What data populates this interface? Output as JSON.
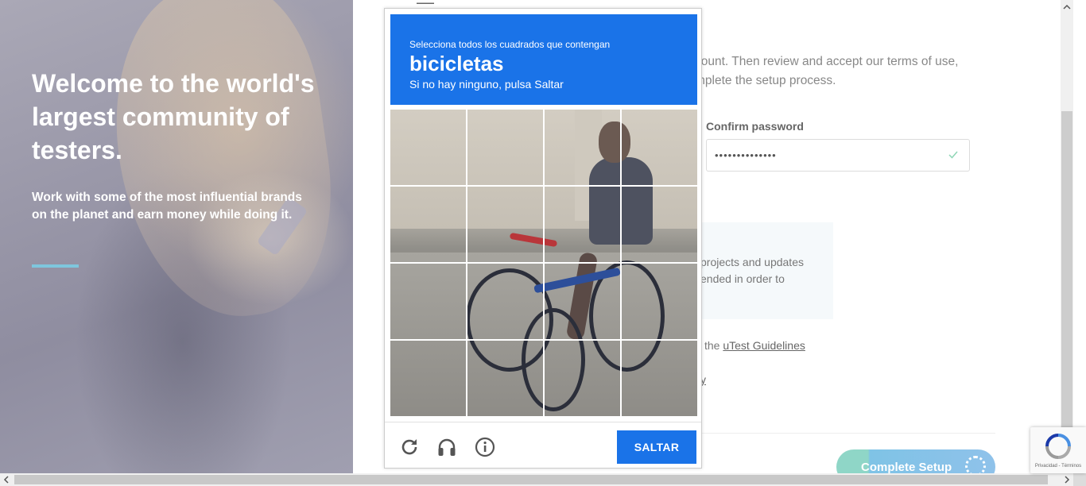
{
  "hero": {
    "title": "Welcome to the world's largest community of testers.",
    "subtitle": "Work with some of the most influential brands on the planet and earn money while doing it."
  },
  "form": {
    "intro_line1": "count. Then review and accept our terms of use,",
    "intro_line2": "mplete the setup process.",
    "confirm_label": "Confirm password",
    "confirm_value": "••••••••••••••",
    "info_line1": "projects and updates",
    "info_line2": "ended in order to",
    "guidelines_prefix": "the ",
    "guidelines_link": "uTest Guidelines",
    "policy_fragment": "y",
    "complete_button": "Complete Setup"
  },
  "captcha": {
    "instruction": "Selecciona todos los cuadrados que contengan",
    "target": "bicicletas",
    "skip_hint": "Si no hay ninguno, pulsa Saltar",
    "skip_button": "SALTAR",
    "grid_rows": 4,
    "grid_cols": 4,
    "icons": [
      "reload-icon",
      "audio-icon",
      "info-icon"
    ],
    "accent_color": "#1a73e8"
  },
  "badge": {
    "text": "Privacidad - Términos"
  }
}
